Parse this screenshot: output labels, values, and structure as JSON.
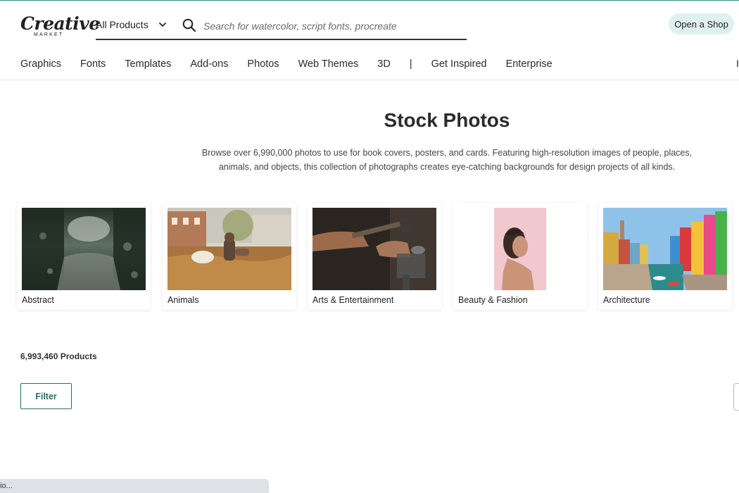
{
  "brand": {
    "name": "Creative",
    "sub": "MARKET"
  },
  "header": {
    "products_select": "All Products",
    "search_placeholder": "Search for watercolor, script fonts, procreate",
    "open_shop": "Open a Shop"
  },
  "nav": {
    "items": [
      "Graphics",
      "Fonts",
      "Templates",
      "Add-ons",
      "Photos",
      "Web Themes",
      "3D"
    ],
    "separator": "|",
    "items_after": [
      "Get Inspired",
      "Enterprise"
    ],
    "edge_char": "I"
  },
  "hero": {
    "title": "Stock Photos",
    "description_line1": "Browse over 6,990,000 photos to use for book covers, posters, and cards. Featuring high-resolution images of people, places,",
    "description_line2": "animals, and objects, this collection of photographs creates eye-catching backgrounds for design projects of all kinds."
  },
  "categories": [
    {
      "label": "Abstract",
      "icon": "forest-reflection-photo"
    },
    {
      "label": "Animals",
      "icon": "dog-autumn-photo"
    },
    {
      "label": "Arts & Entertainment",
      "icon": "hammer-craft-photo"
    },
    {
      "label": "Beauty & Fashion",
      "icon": "woman-portrait-photo"
    },
    {
      "label": "Architecture",
      "icon": "colorful-canal-photo"
    }
  ],
  "results": {
    "count": "6,993,460 Products",
    "filter_label": "Filter"
  },
  "status_bar": {
    "text": "io..."
  },
  "colors": {
    "accent": "#2c6c66",
    "shop_pill": "#dff1ee",
    "top_border": "#2f8f86"
  }
}
